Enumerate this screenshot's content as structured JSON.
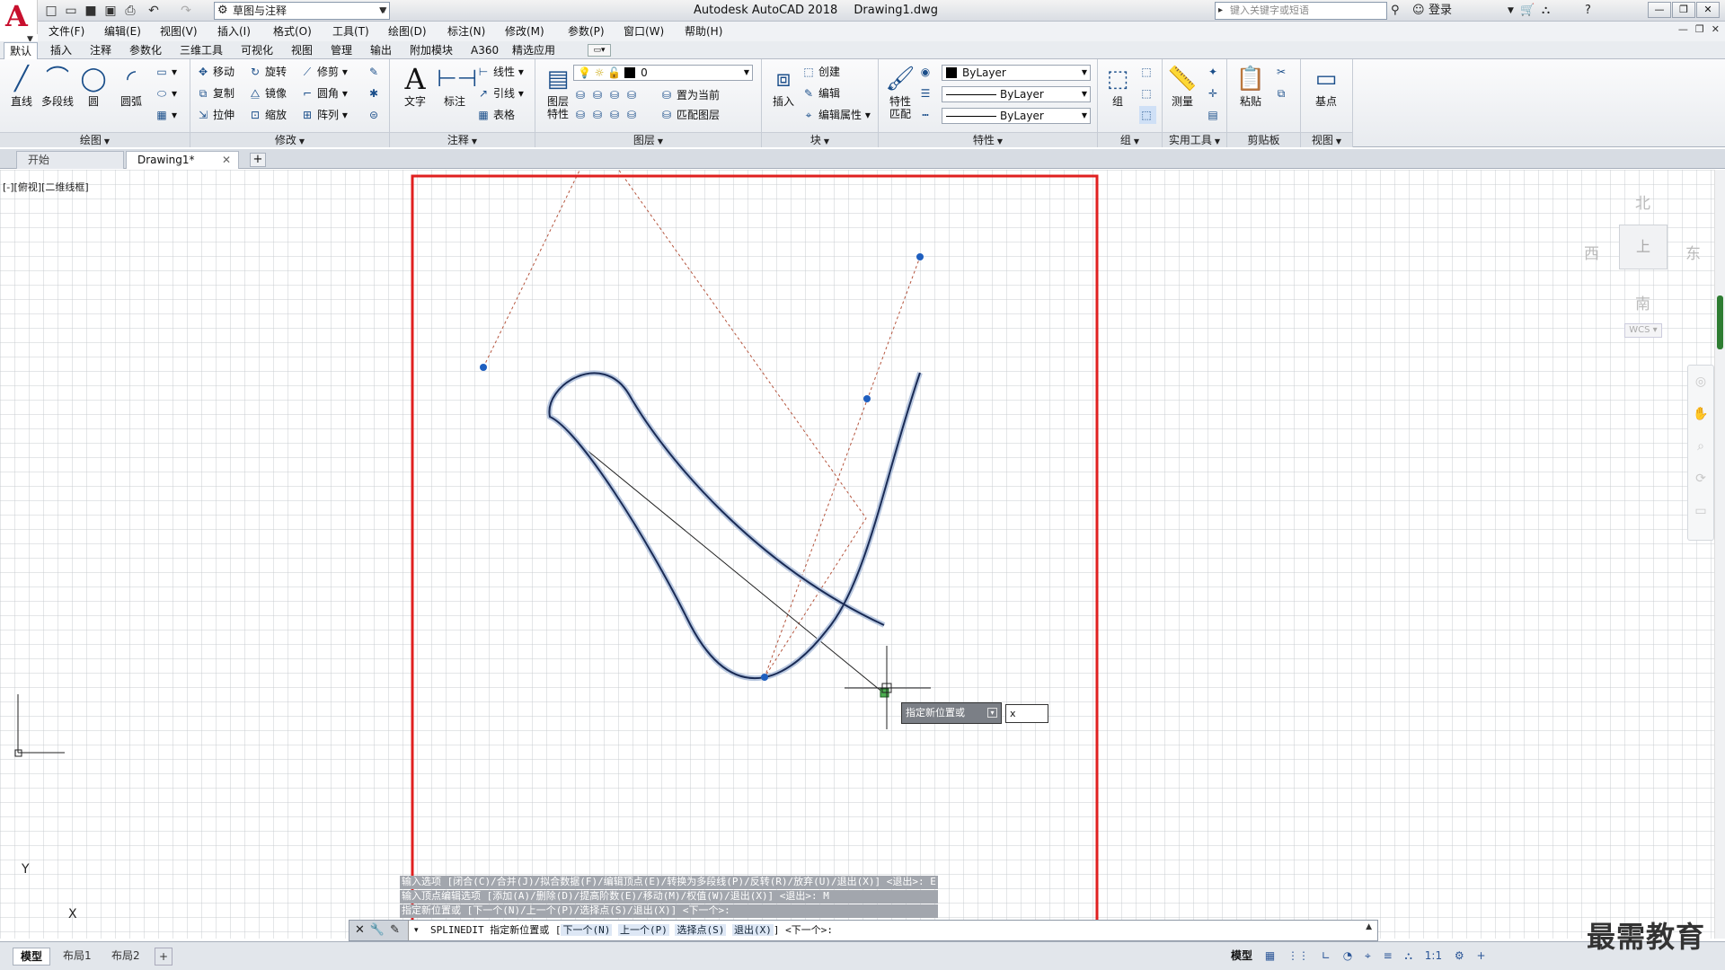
{
  "app": {
    "name": "Autodesk AutoCAD 2018",
    "document": "Drawing1.dwg",
    "workspace": "草图与注释",
    "search_placeholder": "键入关键字或短语",
    "login": "登录"
  },
  "menu": [
    "文件(F)",
    "编辑(E)",
    "视图(V)",
    "插入(I)",
    "格式(O)",
    "工具(T)",
    "绘图(D)",
    "标注(N)",
    "修改(M)",
    "参数(P)",
    "窗口(W)",
    "帮助(H)"
  ],
  "ribbon_tabs": [
    "默认",
    "插入",
    "注释",
    "参数化",
    "三维工具",
    "可视化",
    "视图",
    "管理",
    "输出",
    "附加模块",
    "A360",
    "精选应用"
  ],
  "ribbon": {
    "draw": {
      "title": "绘图",
      "line": "直线",
      "polyline": "多段线",
      "circle": "圆",
      "arc": "圆弧"
    },
    "modify": {
      "title": "修改",
      "move": "移动",
      "rotate": "旋转",
      "trim": "修剪",
      "copy": "复制",
      "mirror": "镜像",
      "fillet": "圆角",
      "stretch": "拉伸",
      "scale": "缩放",
      "array": "阵列"
    },
    "annotation": {
      "title": "注释",
      "text": "文字",
      "dimension": "标注",
      "linear": "线性",
      "leader": "引线",
      "table": "表格"
    },
    "layers": {
      "title": "图层",
      "layer_props": "图层\n特性",
      "layer_props_1": "图层",
      "layer_props_2": "特性",
      "current_layer": "0",
      "set_current": "置为当前",
      "match_layer": "匹配图层"
    },
    "block": {
      "title": "块",
      "insert": "插入",
      "create": "创建",
      "edit": "编辑",
      "edit_attr": "编辑属性"
    },
    "properties": {
      "title": "特性",
      "match_1": "特性",
      "match_2": "匹配",
      "color": "ByLayer",
      "linetype": "ByLayer",
      "lineweight": "ByLayer"
    },
    "groups": {
      "title": "组",
      "group": "组"
    },
    "utilities": {
      "title": "实用工具",
      "measure": "测量"
    },
    "clipboard": {
      "title": "剪贴板",
      "paste": "粘贴"
    },
    "view": {
      "title": "视图",
      "base": "基点"
    }
  },
  "file_tabs": {
    "start": "开始",
    "drawing": "Drawing1*"
  },
  "viewport_label": "[-][俯视][二维线框]",
  "viewcube": {
    "north": "北",
    "south": "南",
    "east": "东",
    "west": "西",
    "top": "上",
    "wcs": "WCS"
  },
  "ucs": {
    "x": "X",
    "y": "Y"
  },
  "dynamic_input": {
    "prompt": "指定新位置或",
    "value": "x"
  },
  "command_history": [
    "输入选项 [闭合(C)/合并(J)/拟合数据(F)/编辑顶点(E)/转换为多段线(P)/反转(R)/放弃(U)/退出(X)] <退出>: E",
    "输入顶点编辑选项 [添加(A)/删除(D)/提高阶数(E)/移动(M)/权值(W)/退出(X)] <退出>: M",
    "指定新位置或 [下一个(N)/上一个(P)/选择点(S)/退出(X)] <下一个>:"
  ],
  "command_line": {
    "prefix": "SPLINEDIT 指定新位置或 [",
    "options": [
      "下一个(N)",
      "上一个(P)",
      "选择点(S)",
      "退出(X)"
    ],
    "suffix": "] <下一个>:"
  },
  "layout_tabs": [
    "模型",
    "布局1",
    "布局2"
  ],
  "status": {
    "model": "模型",
    "scale": "1:1"
  },
  "watermark": "最需教育"
}
